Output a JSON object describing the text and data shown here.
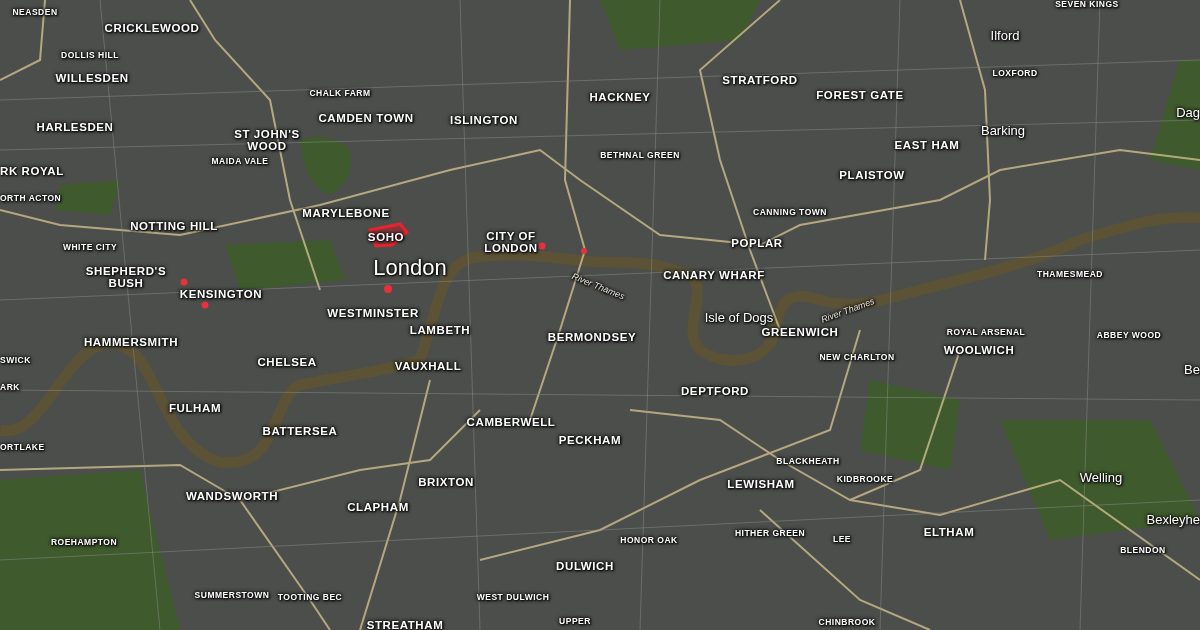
{
  "map": {
    "labels": [
      {
        "text": "NEASDEN",
        "kind": "small"
      },
      {
        "text": "CRICKLEWOOD",
        "kind": "district"
      },
      {
        "text": "DOLLIS HILL",
        "kind": "small"
      },
      {
        "text": "WILLESDEN",
        "kind": "district"
      },
      {
        "text": "HARLESDEN",
        "kind": "district"
      },
      {
        "text": "RK ROYAL",
        "kind": "district"
      },
      {
        "text": "ORTH ACTON",
        "kind": "small"
      },
      {
        "text": "NOTTING HILL",
        "kind": "district"
      },
      {
        "text": "WHITE CITY",
        "kind": "small"
      },
      {
        "text": "SHEPHERD'S\nBUSH",
        "kind": "district"
      },
      {
        "text": "KENSINGTON",
        "kind": "district"
      },
      {
        "text": "CHALK FARM",
        "kind": "small"
      },
      {
        "text": "CAMDEN TOWN",
        "kind": "district"
      },
      {
        "text": "ISLINGTON",
        "kind": "district"
      },
      {
        "text": "ST JOHN'S\nWOOD",
        "kind": "district"
      },
      {
        "text": "MAIDA VALE",
        "kind": "small"
      },
      {
        "text": "MARYLEBONE",
        "kind": "district"
      },
      {
        "text": "SOHO",
        "kind": "district"
      },
      {
        "text": "London",
        "kind": "city"
      },
      {
        "text": "CITY OF\nLONDON",
        "kind": "district"
      },
      {
        "text": "WESTMINSTER",
        "kind": "district"
      },
      {
        "text": "LAMBETH",
        "kind": "district"
      },
      {
        "text": "HACKNEY",
        "kind": "district"
      },
      {
        "text": "BETHNAL GREEN",
        "kind": "small"
      },
      {
        "text": "STRATFORD",
        "kind": "district"
      },
      {
        "text": "FOREST GATE",
        "kind": "district"
      },
      {
        "text": "SEVEN KINGS",
        "kind": "small"
      },
      {
        "text": "Ilford",
        "kind": "town"
      },
      {
        "text": "LOXFORD",
        "kind": "small"
      },
      {
        "text": "Dag",
        "kind": "town"
      },
      {
        "text": "Barking",
        "kind": "town"
      },
      {
        "text": "EAST HAM",
        "kind": "district"
      },
      {
        "text": "PLAISTOW",
        "kind": "district"
      },
      {
        "text": "CANNING TOWN",
        "kind": "small"
      },
      {
        "text": "POPLAR",
        "kind": "district"
      },
      {
        "text": "CANARY WHARF",
        "kind": "district"
      },
      {
        "text": "River Thames",
        "kind": "river"
      },
      {
        "text": "Isle of Dogs",
        "kind": "town"
      },
      {
        "text": "River Thames",
        "kind": "river"
      },
      {
        "text": "THAMESMEAD",
        "kind": "small"
      },
      {
        "text": "BERMONDSEY",
        "kind": "district"
      },
      {
        "text": "GREENWICH",
        "kind": "district"
      },
      {
        "text": "ROYAL ARSENAL",
        "kind": "small"
      },
      {
        "text": "ABBEY WOOD",
        "kind": "small"
      },
      {
        "text": "HAMMERSMITH",
        "kind": "district"
      },
      {
        "text": "WOOLWICH",
        "kind": "district"
      },
      {
        "text": "NEW CHARLTON",
        "kind": "small"
      },
      {
        "text": "SWICK",
        "kind": "small"
      },
      {
        "text": "CHELSEA",
        "kind": "district"
      },
      {
        "text": "VAUXHALL",
        "kind": "district"
      },
      {
        "text": "Be",
        "kind": "town"
      },
      {
        "text": "ARK",
        "kind": "small"
      },
      {
        "text": "DEPTFORD",
        "kind": "district"
      },
      {
        "text": "FULHAM",
        "kind": "district"
      },
      {
        "text": "BATTERSEA",
        "kind": "district"
      },
      {
        "text": "CAMBERWELL",
        "kind": "district"
      },
      {
        "text": "PECKHAM",
        "kind": "district"
      },
      {
        "text": "ORTLAKE",
        "kind": "small"
      },
      {
        "text": "BLACKHEATH",
        "kind": "small"
      },
      {
        "text": "BRIXTON",
        "kind": "district"
      },
      {
        "text": "LEWISHAM",
        "kind": "district"
      },
      {
        "text": "KIDBROOKE",
        "kind": "small"
      },
      {
        "text": "Welling",
        "kind": "town"
      },
      {
        "text": "WANDSWORTH",
        "kind": "district"
      },
      {
        "text": "CLAPHAM",
        "kind": "district"
      },
      {
        "text": "ROEHAMPTON",
        "kind": "small"
      },
      {
        "text": "HONOR OAK",
        "kind": "small"
      },
      {
        "text": "HITHER GREEN",
        "kind": "small"
      },
      {
        "text": "LEE",
        "kind": "small"
      },
      {
        "text": "ELTHAM",
        "kind": "district"
      },
      {
        "text": "Bexleyhe",
        "kind": "town"
      },
      {
        "text": "BLENDON",
        "kind": "small"
      },
      {
        "text": "DULWICH",
        "kind": "district"
      },
      {
        "text": "SUMMERSTOWN",
        "kind": "small"
      },
      {
        "text": "TOOTING BEC",
        "kind": "small"
      },
      {
        "text": "WEST DULWICH",
        "kind": "small"
      },
      {
        "text": "UPPER",
        "kind": "small"
      },
      {
        "text": "STREATHAM",
        "kind": "district"
      },
      {
        "text": "CHINBROOK",
        "kind": "small"
      }
    ]
  }
}
